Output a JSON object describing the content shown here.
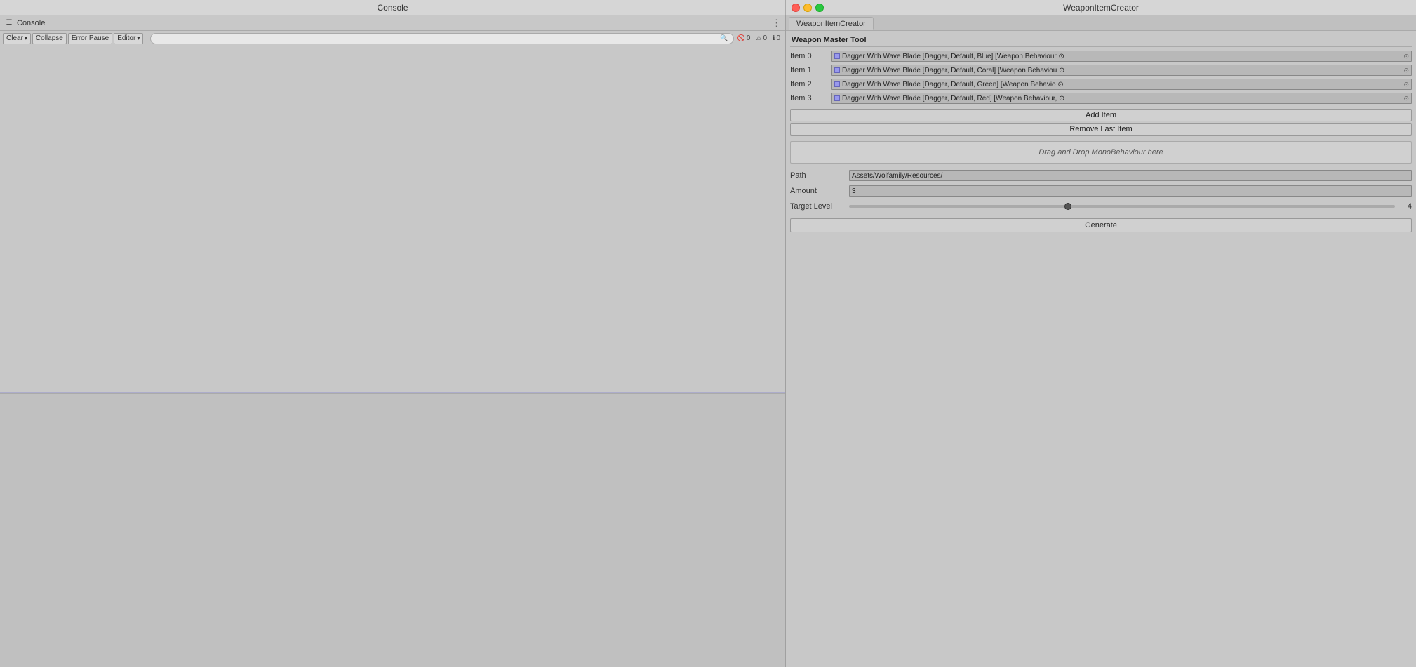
{
  "titleBar": {
    "consoleTitle": "Console",
    "weaponTitle": "WeaponItemCreator"
  },
  "console": {
    "title": "Console",
    "icon": "☰",
    "toolbar": {
      "clearLabel": "Clear",
      "clearDropdown": "▾",
      "collapseLabel": "Collapse",
      "errorPauseLabel": "Error Pause",
      "editorLabel": "Editor",
      "editorDropdown": "▾",
      "searchPlaceholder": "🔍",
      "badge1Icon": "🚫",
      "badge1Count": "0",
      "badge2Icon": "⚠",
      "badge2Count": "0",
      "badge3Icon": "ℹ",
      "badge3Count": "0"
    }
  },
  "rightPanel": {
    "title": "WeaponItemCreator",
    "tabs": [
      {
        "label": "WeaponItemCreator",
        "active": true
      },
      {
        "label": "Weapon Master Tool",
        "active": false
      }
    ],
    "weaponMasterTool": {
      "sectionTitle": "Weapon Master Tool",
      "items": [
        {
          "label": "Item 0",
          "text": "Dagger With Wave Blade [Dagger, Default, Blue] [Weapon Behaviour ⊙",
          "indicator": "◼"
        },
        {
          "label": "Item 1",
          "text": "Dagger With Wave Blade [Dagger, Default, Coral] [Weapon Behaviou ⊙",
          "indicator": "◼"
        },
        {
          "label": "Item 2",
          "text": "Dagger With Wave Blade [Dagger, Default, Green] [Weapon Behavio ⊙",
          "indicator": "◼"
        },
        {
          "label": "Item 3",
          "text": "Dagger With Wave Blade [Dagger, Default, Red] [Weapon Behaviour, ⊙",
          "indicator": "◼"
        }
      ],
      "addItemLabel": "Add Item",
      "removeLastItemLabel": "Remove Last Item",
      "dragDropLabel": "Drag and Drop MonoBehaviour here",
      "pathLabel": "Path",
      "pathValue": "Assets/Wolfamily/Resources/",
      "amountLabel": "Amount",
      "amountValue": "3",
      "targetLevelLabel": "Target Level",
      "targetLevelValue": 4,
      "targetLevelMin": 0,
      "targetLevelMax": 10,
      "targetLevelCurrent": 4,
      "generateLabel": "Generate"
    }
  }
}
